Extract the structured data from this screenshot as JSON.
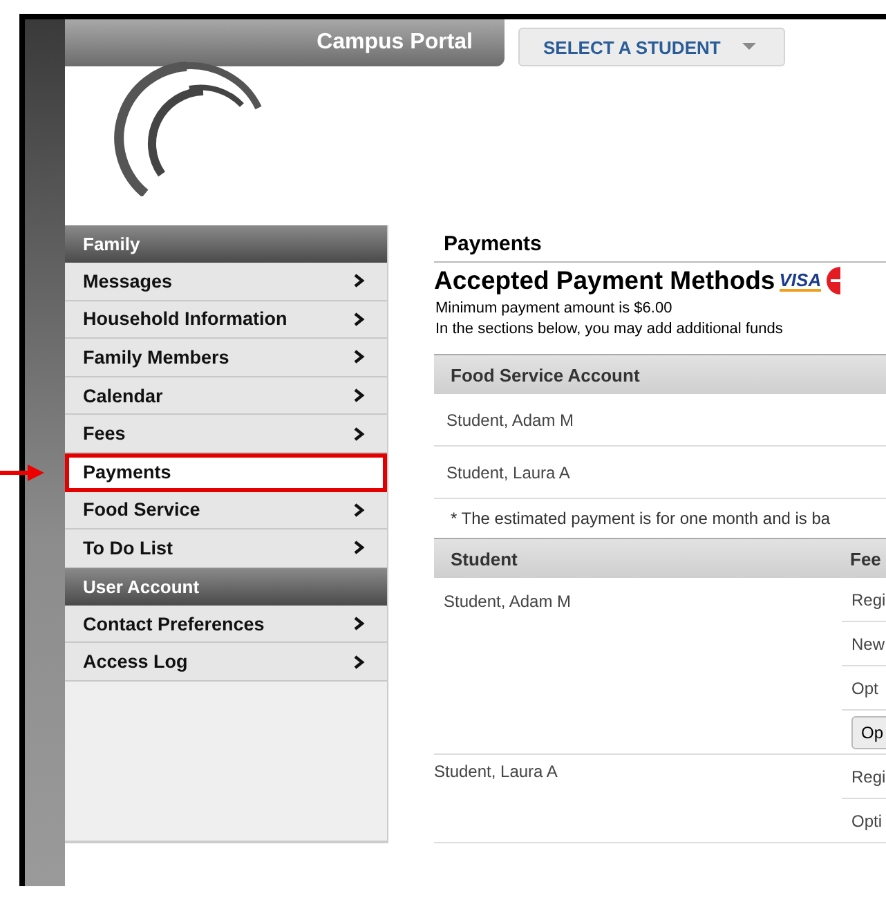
{
  "header": {
    "title": "Campus Portal",
    "student_selector": "SELECT A STUDENT"
  },
  "sidebar": {
    "sections": [
      {
        "title": "Family",
        "items": [
          {
            "label": "Messages",
            "selected": false,
            "highlighted": false
          },
          {
            "label": "Household Information",
            "selected": false,
            "highlighted": false
          },
          {
            "label": "Family Members",
            "selected": false,
            "highlighted": false
          },
          {
            "label": "Calendar",
            "selected": false,
            "highlighted": false
          },
          {
            "label": "Fees",
            "selected": false,
            "highlighted": false
          },
          {
            "label": "Payments",
            "selected": true,
            "highlighted": true
          },
          {
            "label": "Food Service",
            "selected": false,
            "highlighted": false
          },
          {
            "label": "To Do List",
            "selected": false,
            "highlighted": false
          }
        ]
      },
      {
        "title": "User Account",
        "items": [
          {
            "label": "Contact Preferences",
            "selected": false,
            "highlighted": false
          },
          {
            "label": "Access Log",
            "selected": false,
            "highlighted": false
          }
        ]
      }
    ]
  },
  "main": {
    "title": "Payments",
    "heading": "Accepted Payment Methods",
    "card_logos": [
      {
        "kind": "visa",
        "label": "VISA"
      },
      {
        "kind": "mastercard"
      }
    ],
    "notes": [
      "Minimum payment amount is $6.00",
      "In the sections below, you may add additional funds"
    ],
    "food_service": {
      "header": "Food Service Account",
      "rows": [
        "Student, Adam M",
        "Student, Laura A"
      ],
      "footnote": "* The estimated payment is for one month and is ba"
    },
    "fees": {
      "columns": [
        "Student",
        "Fee"
      ],
      "rows": [
        {
          "student": "Student, Adam M",
          "fees": [
            {
              "kind": "text",
              "label": "Regi"
            },
            {
              "kind": "text",
              "label": "New"
            },
            {
              "kind": "text",
              "label": "Opt"
            },
            {
              "kind": "button",
              "label": "Op"
            }
          ]
        },
        {
          "student": "Student, Laura A",
          "fees": [
            {
              "kind": "text",
              "label": "Regi"
            },
            {
              "kind": "text",
              "label": "Opti"
            }
          ]
        }
      ]
    }
  }
}
